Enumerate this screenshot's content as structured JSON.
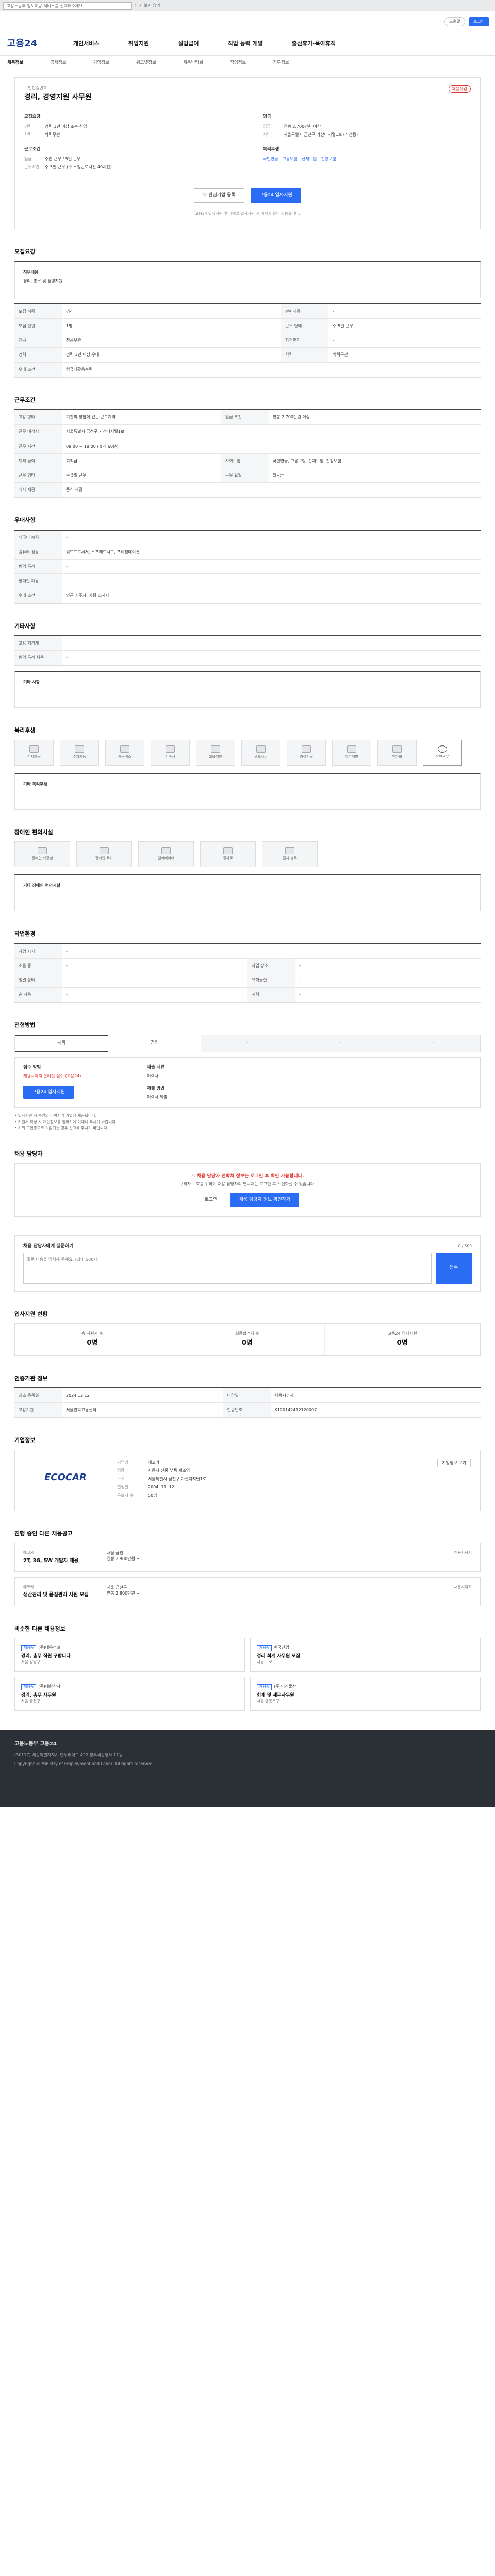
{
  "topbar": {
    "lang_select": "고용노동부 정보제공 서비스를 선택해주세요",
    "checkbox": "다시 보지 않기"
  },
  "util": {
    "help": "도움말",
    "login": "로그인"
  },
  "gnb": {
    "logo": "고용24",
    "menu": [
      "개인서비스",
      "취업지원",
      "실업급여",
      "직업 능력 개발",
      "출산휴가·육아휴직"
    ]
  },
  "subnav": [
    "채용정보",
    "공채정보",
    "기업정보",
    "워크넷정보",
    "채용박람회",
    "직업정보",
    "직무정보"
  ],
  "job": {
    "ref": "구인인증번호",
    "title": "경리, 경영지원 사무원",
    "status_badge": "채용마감",
    "left_label": "모집요강",
    "left": [
      {
        "k": "경력",
        "v": "경력 1년 이상 또는 신입"
      },
      {
        "k": "학력",
        "v": "학력무관"
      }
    ],
    "left2_label": "근로조건",
    "left2": [
      {
        "k": "임금",
        "v": "주간 근무 / 5일 근무"
      },
      {
        "k": "근무시간",
        "v": "주 5일 근무 (주 소정근로시간 40시간)"
      }
    ],
    "right_label": "임금",
    "right": [
      {
        "k": "임금",
        "v": "연봉 2,700만원 이상"
      },
      {
        "k": "지역",
        "v": "서울특별시 금천구 가산디지털1로 (가산동)"
      }
    ],
    "right2_label": "복리후생",
    "right2": [
      "국민연금",
      "고용보험",
      "산재보험",
      "건강보험"
    ],
    "btn_scrap": "관심기업 등록",
    "btn_apply": "고용24 입사지원",
    "note": "고용24 입사지원 및 이메일 입사지원 시 이력서 확인 가능합니다."
  },
  "recruit": {
    "title": "모집요강",
    "duties_h": "직무내용",
    "duties": "경리, 총무 및 경영지원",
    "rows": [
      {
        "k": "모집 직종",
        "v": "경리",
        "k2": "관련직종",
        "v2": "-"
      },
      {
        "k": "모집 인원",
        "v": "1명",
        "k2": "근무 형태",
        "v2": "주 5일 근무"
      },
      {
        "k": "전공",
        "v": "전공무관",
        "k2": "자격면허",
        "v2": "-"
      },
      {
        "k": "경력",
        "v": "경력 1년 이상 우대",
        "k2": "학력",
        "v2": "학력무관"
      },
      {
        "k": "우대 조건",
        "v": "컴퓨터활용능력",
        "k2": "",
        "v2": ""
      }
    ]
  },
  "conditions": {
    "title": "근무조건",
    "rows": [
      {
        "k": "고용 형태",
        "v": "기간의 정함이 없는 근로계약",
        "k2": "임금 조건",
        "v2": "연봉 2,700만원 이상"
      },
      {
        "k": "근무 예정지",
        "v": "서울특별시 금천구 가산디지털1로",
        "k2": "",
        "v2": ""
      },
      {
        "k": "근무 시간",
        "v": "09:00 ~ 18:00 (휴게 60분)",
        "k2": "",
        "v2": ""
      },
      {
        "k": "퇴직 급여",
        "v": "퇴직금",
        "k2": "사회보험",
        "v2": "국민연금, 고용보험, 산재보험, 건강보험"
      },
      {
        "k": "근무 형태",
        "v": "주 5일 근무",
        "k2": "근무 요일",
        "v2": "월~금"
      },
      {
        "k": "식사 제공",
        "v": "중식 제공",
        "k2": "",
        "v2": ""
      }
    ]
  },
  "welfare": {
    "title": "우대사항",
    "rows": [
      {
        "k": "외국어 능력",
        "v": "-"
      },
      {
        "k": "컴퓨터 활용",
        "v": "워드프로세서, 스프레드시트, 프레젠테이션"
      },
      {
        "k": "병역 특례",
        "v": "-"
      },
      {
        "k": "장애인 채용",
        "v": "-"
      },
      {
        "k": "우대 조건",
        "v": "인근 거주자, 차량 소지자"
      }
    ]
  },
  "other": {
    "title": "기타사항",
    "rows": [
      {
        "k": "고용 허가제",
        "v": "-"
      },
      {
        "k": "병역 특례 채용",
        "v": "-"
      }
    ],
    "etc_h": "기타 사항"
  },
  "benefits": {
    "title": "복리후생",
    "icons": [
      "식사제공",
      "주차가능",
      "통근버스",
      "기숙사",
      "교육지원",
      "경조사비",
      "명절선물",
      "자기계발",
      "휴가비",
      "유연근무"
    ],
    "etc_h": "기타 복리후생"
  },
  "disability": {
    "title": "장애인 편의시설",
    "icons": [
      "장애인 화장실",
      "장애인 주차",
      "엘리베이터",
      "경사로",
      "점자 블록"
    ],
    "etc_h": "기타 장애인 편의시설"
  },
  "workenv": {
    "title": "작업환경",
    "rows": [
      {
        "k": "작업 자세",
        "v": "-",
        "k2": "",
        "v2": ""
      },
      {
        "k": "소음 등",
        "v": "-",
        "k2": "작업 장소",
        "v2": "-"
      },
      {
        "k": "청결 상태",
        "v": "-",
        "k2": "유해물질",
        "v2": "-"
      },
      {
        "k": "손 사용",
        "v": "-",
        "k2": "시력",
        "v2": "-"
      }
    ]
  },
  "process": {
    "title": "전형방법",
    "steps": [
      "서류",
      "면접",
      "-",
      "-",
      "-"
    ]
  },
  "apply": {
    "col1_h": "접수 방법",
    "col1_v": "채용시까지 온라인 접수 (고용24)",
    "col2_h": "제출 서류",
    "col2_v": "이력서",
    "col3_h": "제출 방법",
    "col3_v": "이력서 제출",
    "btn": "고용24 입사지원",
    "notes": [
      "• 입사지원 시 본인의 이력서가 기업에 제공됩니다.",
      "• 지원서 작성 시 개인정보를 정확하게 기재해 주시기 바랍니다.",
      "• 허위 구인광고로 의심되는 경우 신고해 주시기 바랍니다."
    ]
  },
  "contact": {
    "title": "채용 담당자",
    "warn": "채용 담당자 연락처 정보는 로그인 후 확인 가능합니다.",
    "desc": "구직자 보호를 위하여 채용 담당자의 연락처는 로그인 후 확인하실 수 있습니다.",
    "btn1": "로그인",
    "btn2": "채용 담당자 정보 확인하기"
  },
  "question": {
    "title": "채용 담당자에게 질문하기",
    "placeholder": "질문 내용을 입력해 주세요. (최대 500자)",
    "send": "등록",
    "count": "0 / 500"
  },
  "stats": {
    "title": "입사지원 현황",
    "items": [
      {
        "l": "총 지원자 수",
        "v": "0명"
      },
      {
        "l": "최종합격자 수",
        "v": "0명"
      },
      {
        "l": "고용24 입사지원",
        "v": "0명"
      }
    ]
  },
  "reg": {
    "title": "인증기관 정보",
    "rows": [
      {
        "k": "최초 등록일",
        "v": "2024.12.12",
        "k2": "마감일",
        "v2": "채용시까지"
      },
      {
        "k": "고용기관",
        "v": "서울관악고용센터",
        "k2": "인증번호",
        "v2": "K120142412120007"
      }
    ]
  },
  "company": {
    "title": "기업정보",
    "logo_text": "ECOCAR",
    "rows": [
      {
        "k": "기업명",
        "v": "에코카"
      },
      {
        "k": "업종",
        "v": "자동차 신품 부품 제조업"
      },
      {
        "k": "주소",
        "v": "서울특별시 금천구 가산디지털1로"
      },
      {
        "k": "설립일",
        "v": "2004. 11. 12"
      },
      {
        "k": "근로자 수",
        "v": "50명"
      }
    ],
    "btn": "기업정보 보기"
  },
  "others": {
    "title": "진행 중인 다른 채용공고",
    "cards": [
      {
        "company": "에코카",
        "title": "2T, 3G, 5W 개발자 채용",
        "loc": "서울 금천구",
        "pay": "연봉 2,900만원 ~",
        "dday": "채용시까지"
      },
      {
        "company": "에코카",
        "title": "생산관리 및 품질관리 사원 모집",
        "loc": "서울 금천구",
        "pay": "연봉 2,800만원 ~",
        "dday": "채용시까지"
      }
    ]
  },
  "similar": {
    "title": "비슷한 다른 채용정보",
    "cards": [
      {
        "tag": "채용중",
        "company": "(주)대우건설",
        "title": "경리, 총무 직원 구합니다",
        "loc": "서울 강남구"
      },
      {
        "tag": "채용중",
        "company": "한국산업",
        "title": "경리 회계 사무원 모집",
        "loc": "서울 구로구"
      },
      {
        "tag": "채용중",
        "company": "(주)대한상사",
        "title": "경리, 총무 사무원",
        "loc": "서울 금천구"
      },
      {
        "tag": "채용중",
        "company": "(주)미래물산",
        "title": "회계 및 세무사무원",
        "loc": "서울 영등포구"
      }
    ]
  },
  "footer": {
    "line1": "고용노동부 고용24",
    "line2": "(30117) 세종특별자치시 한누리대로 422 정부세종청사 11동",
    "line3": "Copyright © Ministry of Employment and Labor. All rights reserved."
  }
}
